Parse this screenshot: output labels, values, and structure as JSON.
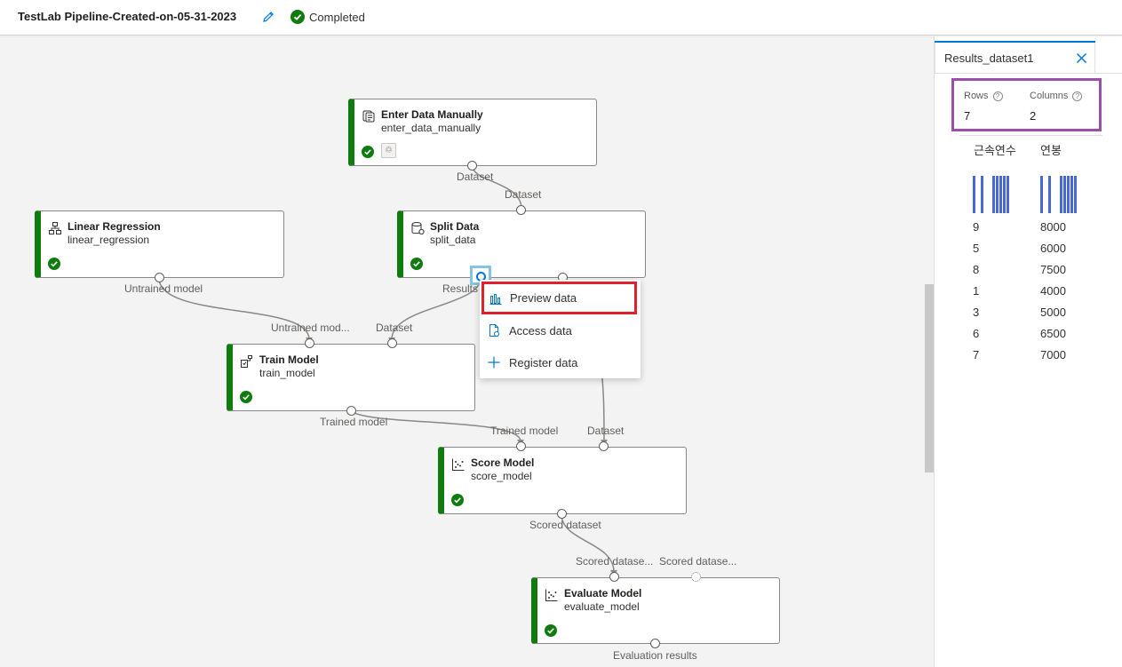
{
  "header": {
    "pipeline_title": "TestLab Pipeline-Created-on-05-31-2023",
    "status": "Completed"
  },
  "colors": {
    "accent": "#0078d4",
    "success": "#107c10",
    "highlight_red": "#e0202a",
    "highlight_purple": "#9b4fa8",
    "histogram_bar": "#4a67d6"
  },
  "nodes": {
    "enter_data": {
      "title": "Enter Data Manually",
      "subtitle": "enter_data_manually",
      "output": "Dataset"
    },
    "linear_regression": {
      "title": "Linear Regression",
      "subtitle": "linear_regression",
      "output": "Untrained model"
    },
    "split_data": {
      "title": "Split Data",
      "subtitle": "split_data",
      "input": "Dataset",
      "output1": "Results"
    },
    "train_model": {
      "title": "Train Model",
      "subtitle": "train_model",
      "input1": "Untrained mod...",
      "input2": "Dataset",
      "output": "Trained model"
    },
    "score_model": {
      "title": "Score Model",
      "subtitle": "score_model",
      "input1": "Trained model",
      "input2": "Dataset",
      "output": "Scored dataset"
    },
    "evaluate_model": {
      "title": "Evaluate Model",
      "subtitle": "evaluate_model",
      "input1": "Scored datase...",
      "input2": "Scored datase...",
      "output": "Evaluation results"
    }
  },
  "context_menu": {
    "items": [
      {
        "label": "Preview data",
        "icon": "bar-chart-icon"
      },
      {
        "label": "Access data",
        "icon": "document-icon"
      },
      {
        "label": "Register data",
        "icon": "plus-icon"
      }
    ]
  },
  "results_panel": {
    "tab_label": "Results_dataset1",
    "rows_label": "Rows",
    "rows_value": "7",
    "columns_label": "Columns",
    "columns_value": "2",
    "columns": [
      "근속연수",
      "연봉"
    ],
    "rows": [
      [
        "9",
        "8000"
      ],
      [
        "5",
        "6000"
      ],
      [
        "8",
        "7500"
      ],
      [
        "1",
        "4000"
      ],
      [
        "3",
        "5000"
      ],
      [
        "6",
        "6500"
      ],
      [
        "7",
        "7000"
      ]
    ]
  }
}
